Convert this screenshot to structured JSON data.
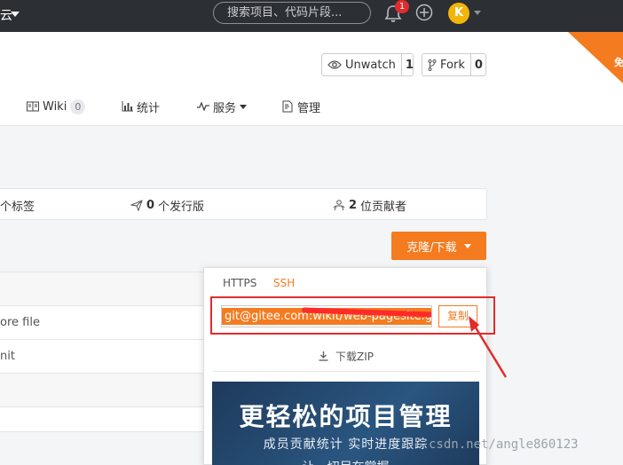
{
  "topbar": {
    "brand_text": "云",
    "search_placeholder": "搜索项目、代码片段...",
    "notification_count": "1",
    "avatar_letter": "K"
  },
  "corner_ribbon_text": "免",
  "repo_actions": {
    "watch_label": "Unwatch",
    "watch_count": "1",
    "fork_label": "Fork",
    "fork_count": "0"
  },
  "nav": {
    "wiki_label": "Wiki",
    "wiki_count": "0",
    "stats_label": "统计",
    "services_label": "服务",
    "manage_label": "管理"
  },
  "stats_bar": {
    "tags_text": "个标签",
    "releases_count": "0",
    "releases_text": "个发行版",
    "contributors_count": "2",
    "contributors_text": "位贡献者"
  },
  "clone_button_label": "克隆/下载",
  "file_rows": [
    {
      "text": ""
    },
    {
      "text": "ore file"
    },
    {
      "text": "nit"
    },
    {
      "text": ""
    },
    {
      "text": ""
    }
  ],
  "clone_dropdown": {
    "tab_https": "HTTPS",
    "tab_ssh": "SSH",
    "url_value": "git@gitee.com:wikit/web-pagesite.git",
    "copy_label": "复制",
    "download_zip_label": "下载ZIP",
    "banner_title": "更轻松的项目管理",
    "banner_subtitle": "成员贡献统计  实时进度跟踪",
    "banner_subtitle2": "让一切尽在掌握"
  },
  "watermark": "csdn.net/angle860123",
  "colors": {
    "accent": "#f47b20",
    "topbar_bg": "#2c2f33",
    "highlight_red": "#e02c2c"
  }
}
